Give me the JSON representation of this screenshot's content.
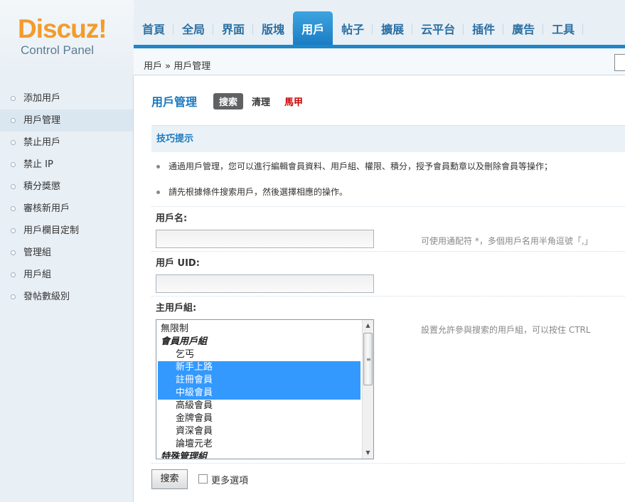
{
  "logo": {
    "brand": "Discuz!",
    "sub": "Control Panel"
  },
  "nav": {
    "tabs": [
      "首頁",
      "全局",
      "界面",
      "版塊",
      "用戶",
      "帖子",
      "擴展",
      "云平台",
      "插件",
      "廣告",
      "工具"
    ],
    "active_index": 4
  },
  "breadcrumb": "用戶 » 用戶管理",
  "sidebar": {
    "items": [
      "添加用戶",
      "用戶管理",
      "禁止用戶",
      "禁止 IP",
      "積分獎懲",
      "審核新用戶",
      "用戶欄目定制",
      "管理組",
      "用戶組",
      "發帖數級別"
    ],
    "active_index": 1
  },
  "main": {
    "title": "用戶管理",
    "subtabs": {
      "search": "搜索",
      "clean": "清理",
      "vest": "馬甲"
    },
    "tips_title": "技巧提示",
    "tips": [
      "通過用戶管理，您可以進行編輯會員資料、用戶組、權限、積分，授予會員勳章以及刪除會員等操作；",
      "請先根據條件搜索用戶，然後選擇相應的操作。"
    ],
    "username": {
      "label": "用戶名:",
      "value": "",
      "hint": "可使用通配符 *，多個用戶名用半角逗號「,」"
    },
    "uid": {
      "label": "用戶 UID:",
      "value": ""
    },
    "group": {
      "label": "主用戶組:",
      "hint": "設置允許參與搜索的用戶組，可以按住 CTRL",
      "options": [
        {
          "text": "無限制",
          "selected": false
        },
        {
          "text": "會員用戶組",
          "selected": false
        },
        {
          "text": "乞丐",
          "selected": false
        },
        {
          "text": "新手上路",
          "selected": true
        },
        {
          "text": "註冊會員",
          "selected": true
        },
        {
          "text": "中級會員",
          "selected": true
        },
        {
          "text": "高級會員",
          "selected": false
        },
        {
          "text": "金牌會員",
          "selected": false
        },
        {
          "text": "資深會員",
          "selected": false
        },
        {
          "text": "論壇元老",
          "selected": false
        },
        {
          "text": "特殊管理組",
          "selected": false
        }
      ]
    },
    "search_button": "搜索",
    "more_options": "更多選項"
  }
}
